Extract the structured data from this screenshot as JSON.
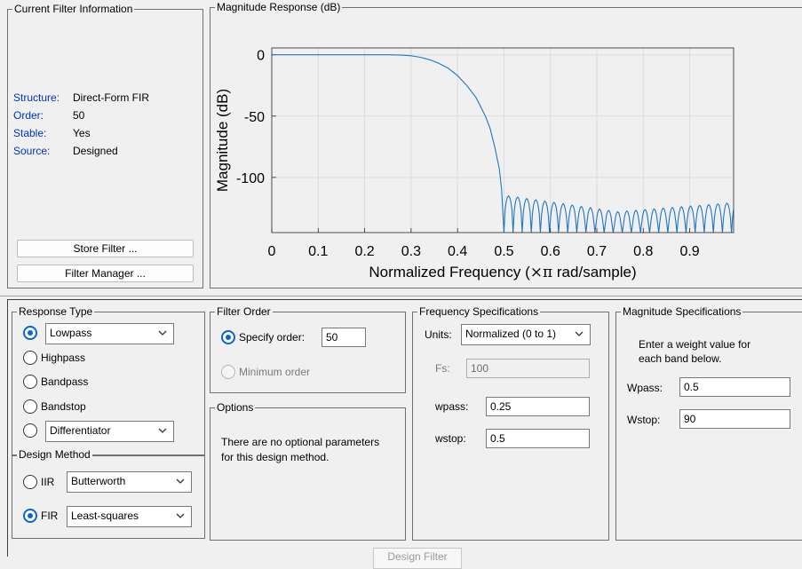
{
  "filter_info": {
    "title": "Current Filter Information",
    "rows": [
      {
        "label": "Structure:",
        "value": "Direct-Form FIR"
      },
      {
        "label": "Order:",
        "value": "50"
      },
      {
        "label": "Stable:",
        "value": "Yes"
      },
      {
        "label": "Source:",
        "value": "Designed"
      }
    ],
    "store_button": "Store Filter ...",
    "manager_button": "Filter Manager ..."
  },
  "plot_panel": {
    "title": "Magnitude Response (dB)"
  },
  "chart_data": {
    "type": "line",
    "title": "",
    "xlabel": "Normalized Frequency (×π rad/sample)",
    "xlabel_parts": {
      "pre": "Normalized Frequency (",
      "sym": "×π",
      "post": " rad/sample)"
    },
    "ylabel": "Magnitude (dB)",
    "xlim": [
      0,
      1
    ],
    "ylim": [
      -150,
      5
    ],
    "xticks": [
      0,
      0.1,
      0.2,
      0.3,
      0.4,
      0.5,
      0.6,
      0.7,
      0.8,
      0.9
    ],
    "xtick_labels": [
      "0",
      "0.1",
      "0.2",
      "0.3",
      "0.4",
      "0.5",
      "0.6",
      "0.7",
      "0.8",
      "0.9"
    ],
    "yticks": [
      0,
      -50,
      -100
    ],
    "ytick_labels": [
      "0",
      "-50",
      "-100"
    ],
    "grid": true,
    "series_color": "#1f77c4",
    "series": [
      {
        "x": [
          0,
          0.05,
          0.1,
          0.15,
          0.2,
          0.25,
          0.28,
          0.3,
          0.32,
          0.34,
          0.36,
          0.38,
          0.4,
          0.42,
          0.44,
          0.46,
          0.47,
          0.48,
          0.49,
          0.495,
          0.5
        ],
        "y": [
          0,
          0,
          0,
          0,
          0,
          0,
          -0.3,
          -0.8,
          -2,
          -4,
          -7,
          -11,
          -17,
          -25,
          -35,
          -50,
          -60,
          -75,
          -93,
          -110,
          -150
        ]
      }
    ],
    "stopband": {
      "start": 0.5,
      "lobe_width": 0.0196,
      "floor": -150,
      "peak_start": -115,
      "peak_mid": -128,
      "peak_end": -121
    }
  },
  "response_type": {
    "title": "Response Type",
    "options": [
      "Lowpass",
      "Highpass",
      "Bandpass",
      "Bandstop"
    ],
    "selected": "Lowpass",
    "lowpass_select": "Lowpass",
    "differentiator_select": "Differentiator"
  },
  "design_method": {
    "title": "Design Method",
    "iir_label": "IIR",
    "iir_value": "Butterworth",
    "fir_label": "FIR",
    "fir_value": "Least-squares",
    "selected": "FIR"
  },
  "filter_order": {
    "title": "Filter Order",
    "specify_label": "Specify order:",
    "order_value": "50",
    "minimum_label": "Minimum order",
    "selected": "Specify order"
  },
  "options": {
    "title": "Options",
    "message": "There are no optional parameters",
    "message2": "for this design method."
  },
  "frequency_specs": {
    "title": "Frequency Specifications",
    "units_label": "Units:",
    "units_value": "Normalized (0 to 1)",
    "fs_label": "Fs:",
    "fs_value": "100",
    "wpass_label": "wpass:",
    "wpass_value": "0.25",
    "wstop_label": "wstop:",
    "wstop_value": "0.5"
  },
  "magnitude_specs": {
    "title": "Magnitude Specifications",
    "instruction": "Enter a weight value for",
    "instruction2": "each band below.",
    "wpass_label": "Wpass:",
    "wpass_value": "0.5",
    "wstop_label": "Wstop:",
    "wstop_value": "90"
  },
  "design_button": "Design Filter"
}
